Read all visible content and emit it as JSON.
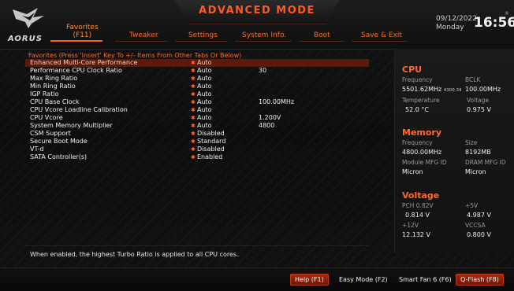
{
  "header": {
    "title": "ADVANCED MODE",
    "brand": "AORUS",
    "date": "09/12/2022",
    "day": "Monday",
    "time": "16:56",
    "registered_mark": "®"
  },
  "tabs": [
    {
      "line1": "Favorites",
      "line2": "(F11)",
      "active": true
    },
    {
      "label": "Tweaker"
    },
    {
      "label": "Settings"
    },
    {
      "label": "System Info."
    },
    {
      "label": "Boot"
    },
    {
      "label": "Save & Exit"
    }
  ],
  "favorites": {
    "hint": "Favorites (Press 'Insert' Key To +/- Items From Other Tabs Or Below)",
    "rows": [
      {
        "label": "Enhanced Multi-Core Performance",
        "value": "Auto",
        "current": "",
        "selected": true
      },
      {
        "label": "Performance CPU Clock Ratio",
        "value": "Auto",
        "current": "30"
      },
      {
        "label": "Max Ring Ratio",
        "value": "Auto",
        "current": ""
      },
      {
        "label": "Min Ring Ratio",
        "value": "Auto",
        "current": ""
      },
      {
        "label": "IGP Ratio",
        "value": "Auto",
        "current": ""
      },
      {
        "label": "CPU Base Clock",
        "value": "Auto",
        "current": "100.00MHz"
      },
      {
        "label": "CPU Vcore Loadline Calibration",
        "value": "Auto",
        "current": ""
      },
      {
        "label": "CPU Vcore",
        "value": "Auto",
        "current": "1.200V"
      },
      {
        "label": "System Memory Multiplier",
        "value": "Auto",
        "current": "4800"
      },
      {
        "label": "CSM Support",
        "value": "Disabled",
        "current": ""
      },
      {
        "label": "Secure Boot Mode",
        "value": "Standard",
        "current": ""
      },
      {
        "label": "VT-d",
        "value": "Disabled",
        "current": ""
      },
      {
        "label": "SATA Controller(s)",
        "value": "Enabled",
        "current": ""
      }
    ]
  },
  "help_text": "When enabled, the highest Turbo Ratio is applied to all CPU cores.",
  "cpu": {
    "title": "CPU",
    "freq_label": "Frequency",
    "freq_value": "5501.62MHz",
    "freq_sub": "4300.34",
    "bclk_label": "BCLK",
    "bclk_value": "100.00MHz",
    "temp_label": "Temperature",
    "temp_value": "52.0 °C",
    "volt_label": "Voltage",
    "volt_value": "0.975 V"
  },
  "memory": {
    "title": "Memory",
    "freq_label": "Frequency",
    "freq_value": "4800.00MHz",
    "size_label": "Size",
    "size_value": "8192MB",
    "mod_label": "Module MFG ID",
    "mod_value": "Micron",
    "dram_label": "DRAM MFG ID",
    "dram_value": "Micron"
  },
  "voltage": {
    "title": "Voltage",
    "pch_label": "PCH 0.82V",
    "pch_value": "0.814 V",
    "p5_label": "+5V",
    "p5_value": "4.987 V",
    "p12_label": "+12V",
    "p12_value": "12.132 V",
    "vccsa_label": "VCCSA",
    "vccsa_value": "0.800 V"
  },
  "bottom_bar": {
    "help": "Help (F1)",
    "easy": "Easy Mode (F2)",
    "fan": "Smart Fan 6 (F6)",
    "qflash": "Q-Flash (F8)"
  },
  "colors": {
    "accent": "#ff5a1f",
    "selected_row": "#5a1a0f"
  }
}
